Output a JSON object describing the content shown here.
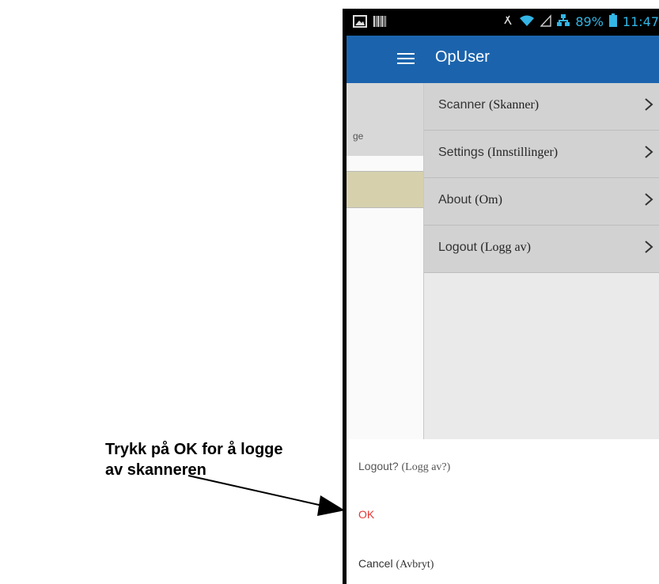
{
  "callout": {
    "line1": "Trykk på OK for å logge",
    "line2": "av skanneren"
  },
  "statusbar": {
    "battery": "89%",
    "time": "11:47",
    "icons": [
      "image-icon",
      "barcode-icon",
      "mute-icon",
      "wifi-icon",
      "signal-icon",
      "network-icon",
      "battery-icon"
    ]
  },
  "appbar": {
    "title": "OpUser"
  },
  "background": {
    "partial_text": "ge"
  },
  "drawer": {
    "items": [
      {
        "label": "Scanner",
        "translation": "(Skanner)"
      },
      {
        "label": "Settings",
        "translation": "(Innstillinger)"
      },
      {
        "label": "About",
        "translation": "(Om)"
      },
      {
        "label": "Logout",
        "translation": "(Logg av)"
      }
    ]
  },
  "dialog": {
    "title": "Logout?",
    "title_translation": "(Logg av?)",
    "ok": "OK",
    "cancel": "Cancel",
    "cancel_translation": "(Avbryt)"
  },
  "colors": {
    "appbar": "#1b64ad",
    "status_accent": "#33b5e5",
    "ok": "#e53935",
    "menu_item": "#d2d2d2",
    "bg_highlight": "#d6d0ad"
  }
}
